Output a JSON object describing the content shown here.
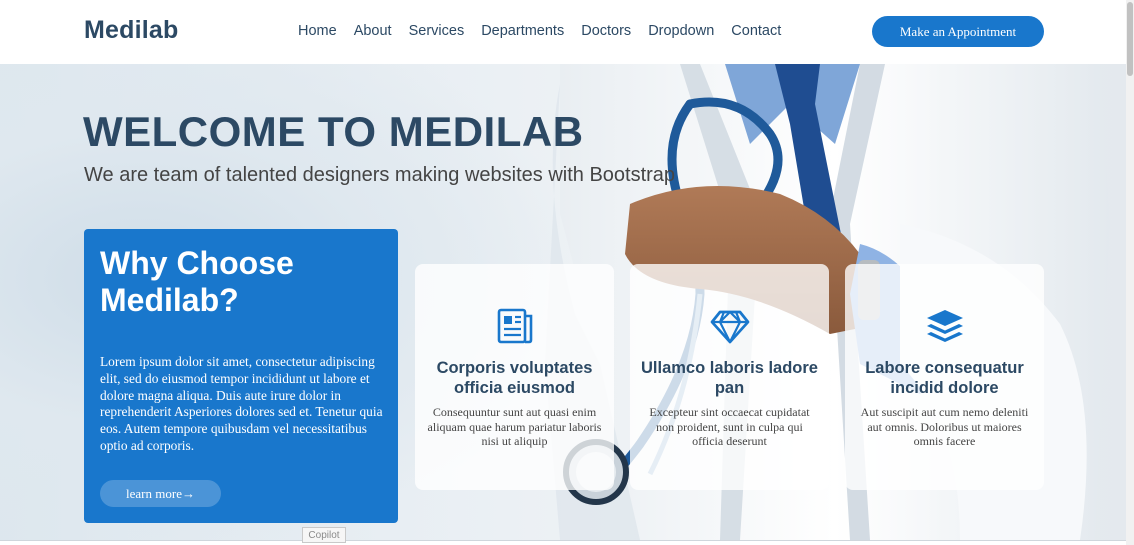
{
  "header": {
    "logo": "Medilab",
    "nav": [
      "Home",
      "About",
      "Services",
      "Departments",
      "Doctors",
      "Dropdown",
      "Contact"
    ],
    "appointment_button": "Make an Appointment"
  },
  "hero": {
    "title": "WELCOME TO MEDILAB",
    "subtitle": "We are team of talented designers making websites with Bootstrap"
  },
  "why_box": {
    "title": "Why Choose Medilab?",
    "text": "Lorem ipsum dolor sit amet, consectetur adipiscing elit, sed do eiusmod tempor incididunt ut labore et dolore magna aliqua. Duis aute irure dolor in reprehenderit Asperiores dolores sed et. Tenetur quia eos. Autem tempore quibusdam vel necessitatibus optio ad corporis.",
    "button": "learn more→"
  },
  "cards": [
    {
      "icon": "clipboard-data-icon",
      "title": "Corporis voluptates officia eiusmod",
      "text": "Consequuntur sunt aut quasi enim aliquam quae harum pariatur laboris nisi ut aliquip"
    },
    {
      "icon": "gem-icon",
      "title": "Ullamco laboris ladore pan",
      "text": "Excepteur sint occaecat cupidatat non proident, sunt in culpa qui officia deserunt"
    },
    {
      "icon": "layers-icon",
      "title": "Labore consequatur incidid dolore",
      "text": "Aut suscipit aut cum nemo deleniti aut omnis. Doloribus ut maiores omnis facere"
    }
  ],
  "overlay": {
    "copilot_label": "Copilot"
  },
  "colors": {
    "primary": "#1977cc",
    "heading": "#2c4964",
    "text": "#444444"
  }
}
